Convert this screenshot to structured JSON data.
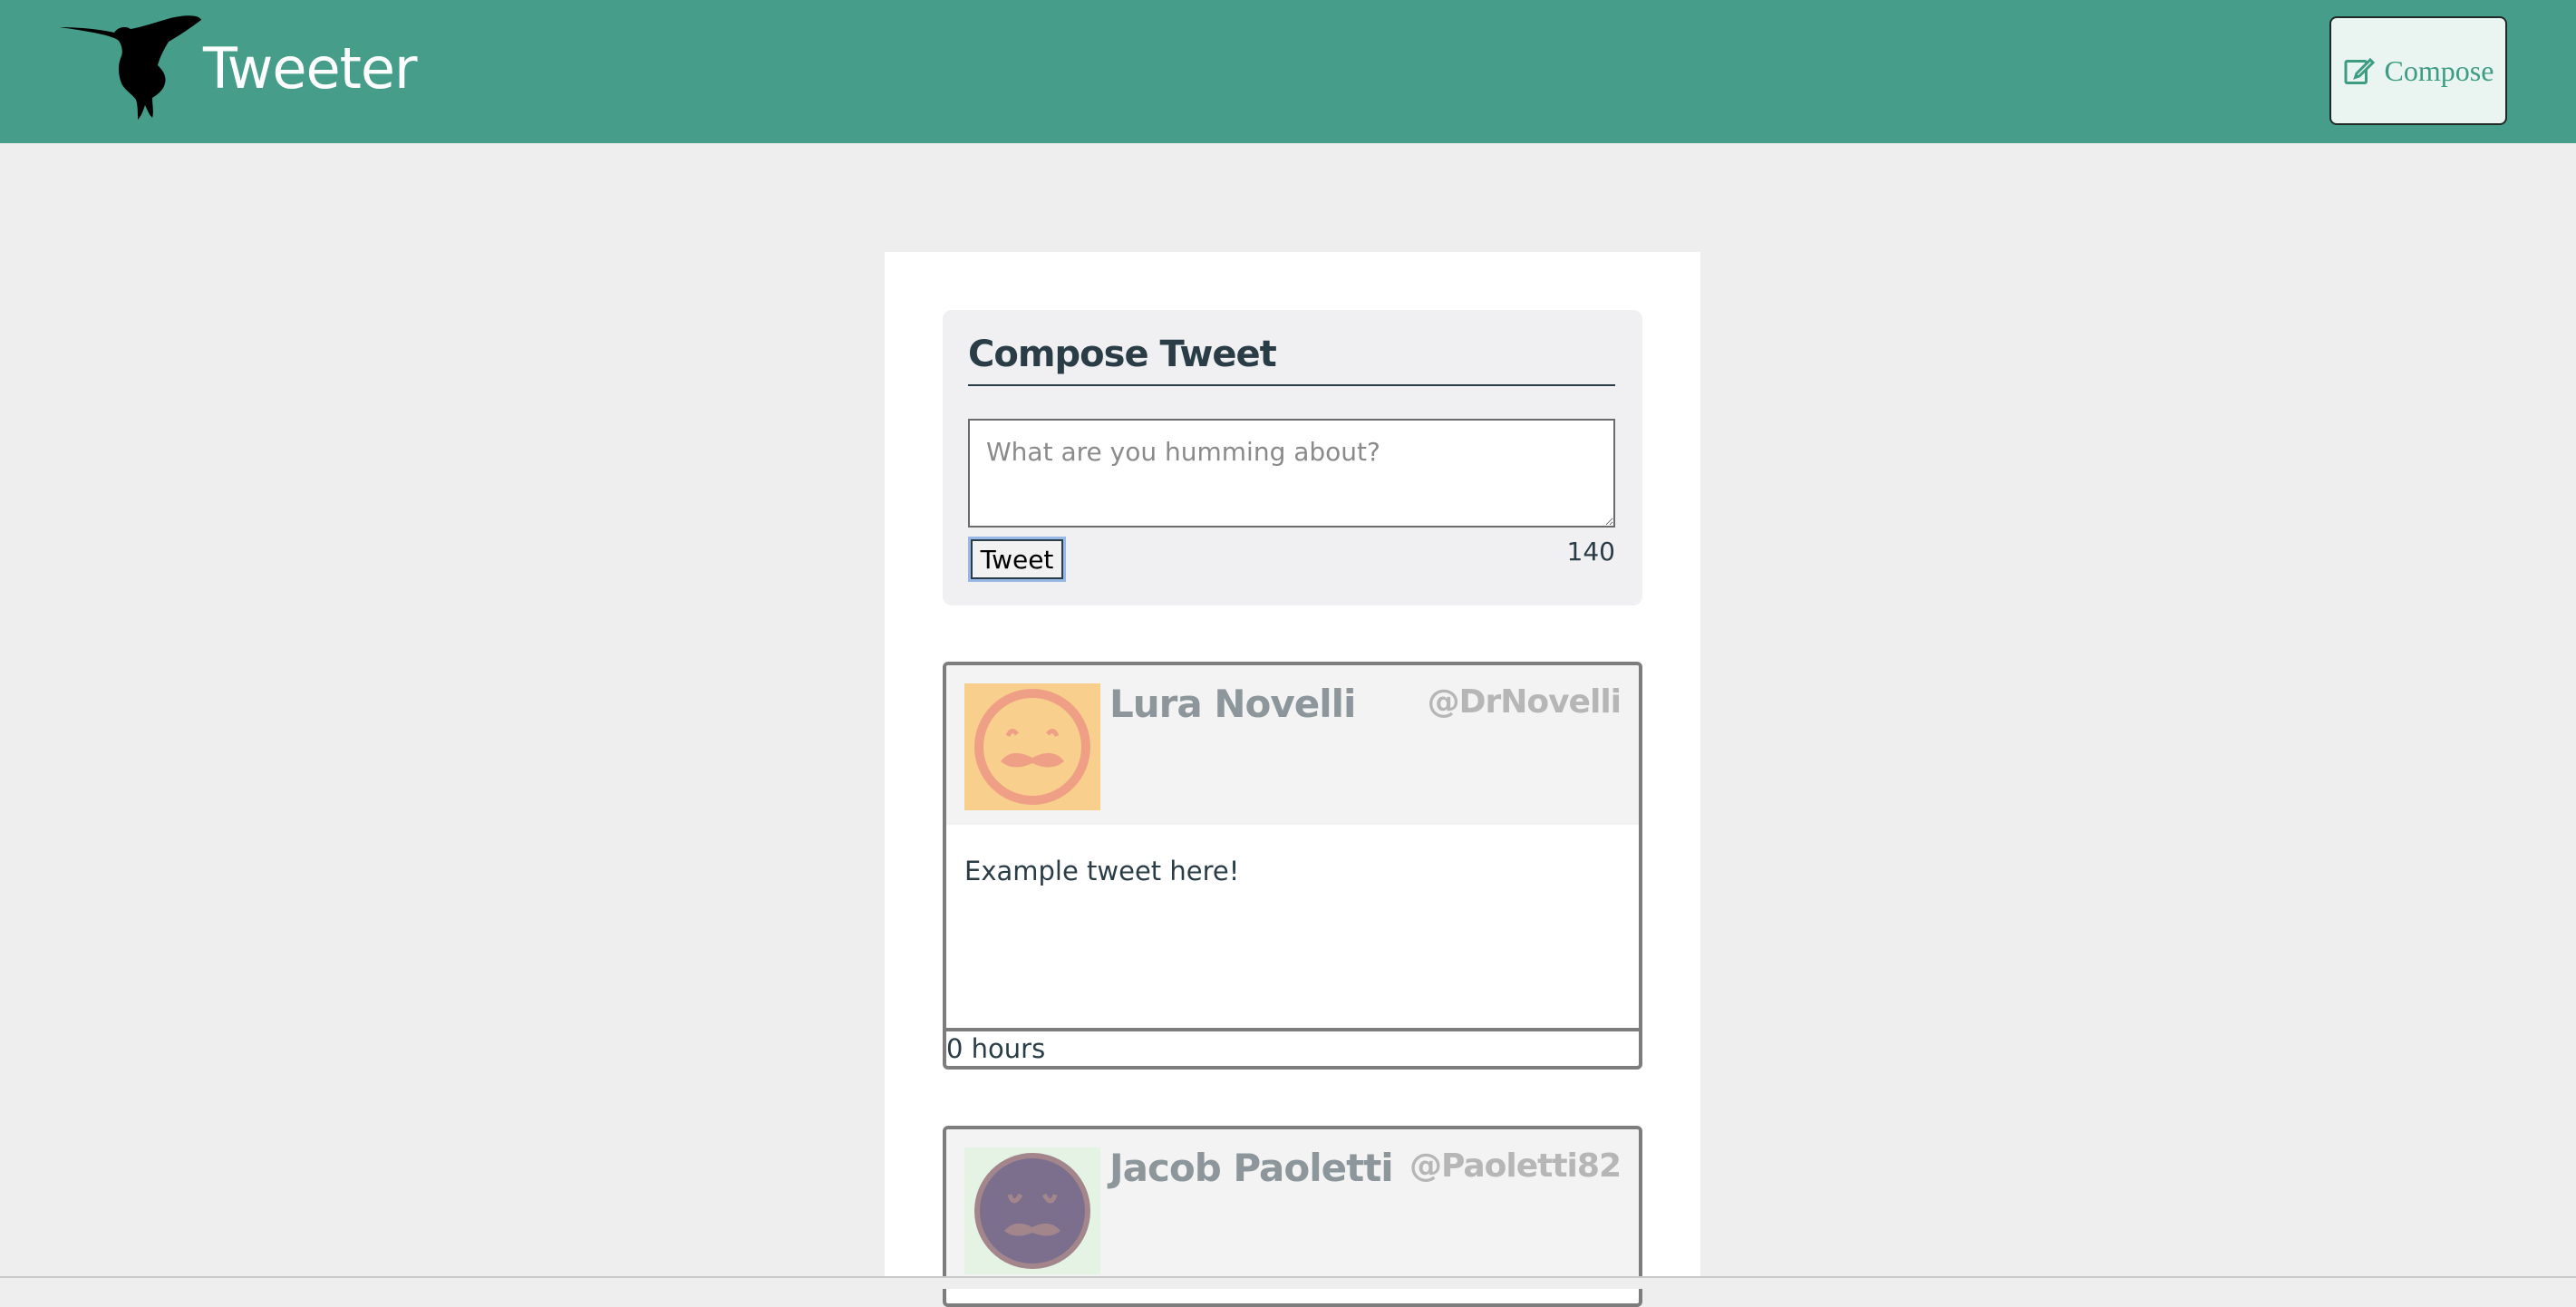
{
  "nav": {
    "brand": "Tweeter",
    "logo_icon": "hummingbird-icon",
    "compose_label": "Compose",
    "compose_icon": "edit-icon",
    "background_color": "#469e8a"
  },
  "new_tweet": {
    "heading": "Compose Tweet",
    "placeholder": "What are you humming about?",
    "value": "",
    "submit_label": "Tweet",
    "counter": "140"
  },
  "tweets": [
    {
      "name": "Lura Novelli",
      "handle": "@DrNovelli",
      "content": "Example tweet here!",
      "timestamp": "0 hours",
      "avatar_icon": "mustache-face-avatar",
      "avatar_bg": "#f8cf8c"
    },
    {
      "name": "Jacob Paoletti",
      "handle": "@Paoletti82",
      "avatar_icon": "mustache-face-avatar",
      "avatar_bg": "#e4f3e4"
    }
  ]
}
